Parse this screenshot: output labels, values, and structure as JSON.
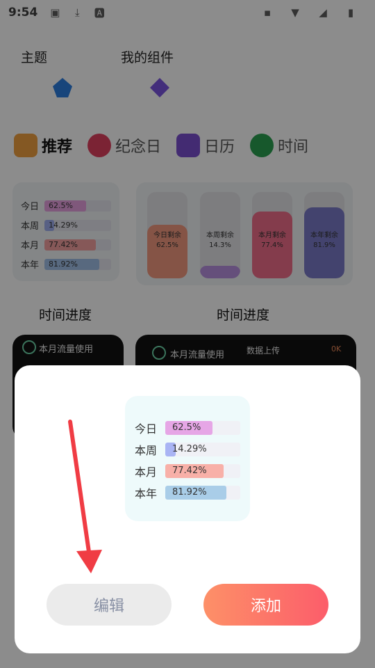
{
  "status_bar": {
    "time": "9:54",
    "left_icons": [
      "image-icon",
      "download-icon",
      "text-a-icon"
    ],
    "right_icons": [
      "briefcase-icon",
      "wifi-icon",
      "signal-icon",
      "battery-charging-icon"
    ]
  },
  "top_categories": [
    {
      "label": "主题",
      "icon": "theme-icon",
      "color": "#2d7fe0"
    },
    {
      "label": "我的组件",
      "icon": "widgets-icon",
      "color": "#7b55e0"
    }
  ],
  "tabs": [
    {
      "label": "推荐",
      "icon": "star-box-icon",
      "color": "#f0a040",
      "active": true
    },
    {
      "label": "纪念日",
      "icon": "heart-icon",
      "color": "#e04060",
      "active": false
    },
    {
      "label": "日历",
      "icon": "calendar-30-icon",
      "color": "#7a4fd0",
      "active": false
    },
    {
      "label": "时间",
      "icon": "clock-icon",
      "color": "#2aa050",
      "active": false
    }
  ],
  "widget_cards": {
    "list_card": {
      "rows": [
        {
          "label": "今日",
          "value": "62.5%",
          "fraction": 0.625,
          "color": "#e8a0e0"
        },
        {
          "label": "本周",
          "value": "14.29%",
          "fraction": 0.1429,
          "color": "#a0b0f0"
        },
        {
          "label": "本月",
          "value": "77.42%",
          "fraction": 0.7742,
          "color": "#f4a0a0"
        },
        {
          "label": "本年",
          "value": "81.92%",
          "fraction": 0.8192,
          "color": "#a0c0e8"
        }
      ]
    },
    "column_card": {
      "columns": [
        {
          "label": "今日剩余",
          "value": "62.5%",
          "fraction": 0.625,
          "color": "#f29a80"
        },
        {
          "label": "本周剩余",
          "value": "14.3%",
          "fraction": 0.143,
          "color": "#b890e0"
        },
        {
          "label": "本月剩余",
          "value": "77.4%",
          "fraction": 0.774,
          "color": "#f06e8a"
        },
        {
          "label": "本年剩余",
          "value": "81.9%",
          "fraction": 0.819,
          "color": "#7a7ac8"
        }
      ]
    }
  },
  "section_titles": [
    "时间进度",
    "时间进度"
  ],
  "dark_cards": [
    {
      "label": "本月流量使用"
    },
    {
      "label": "本月流量使用",
      "extra_label": "数据上传",
      "extra_value": "0K"
    }
  ],
  "sheet": {
    "preview_rows": [
      {
        "label": "今日",
        "value": "62.5%",
        "fraction": 0.625,
        "color": "#e6a6e6"
      },
      {
        "label": "本周",
        "value": "14.29%",
        "fraction": 0.1429,
        "color": "#a9b4f4"
      },
      {
        "label": "本月",
        "value": "77.42%",
        "fraction": 0.7742,
        "color": "#f8b0a8"
      },
      {
        "label": "本年",
        "value": "81.92%",
        "fraction": 0.8192,
        "color": "#a9cde8"
      }
    ],
    "edit_label": "编辑",
    "add_label": "添加"
  },
  "colors": {
    "arrow": "#f03c44",
    "add_gradient_start": "#fd9068",
    "add_gradient_end": "#fc5d6a"
  }
}
